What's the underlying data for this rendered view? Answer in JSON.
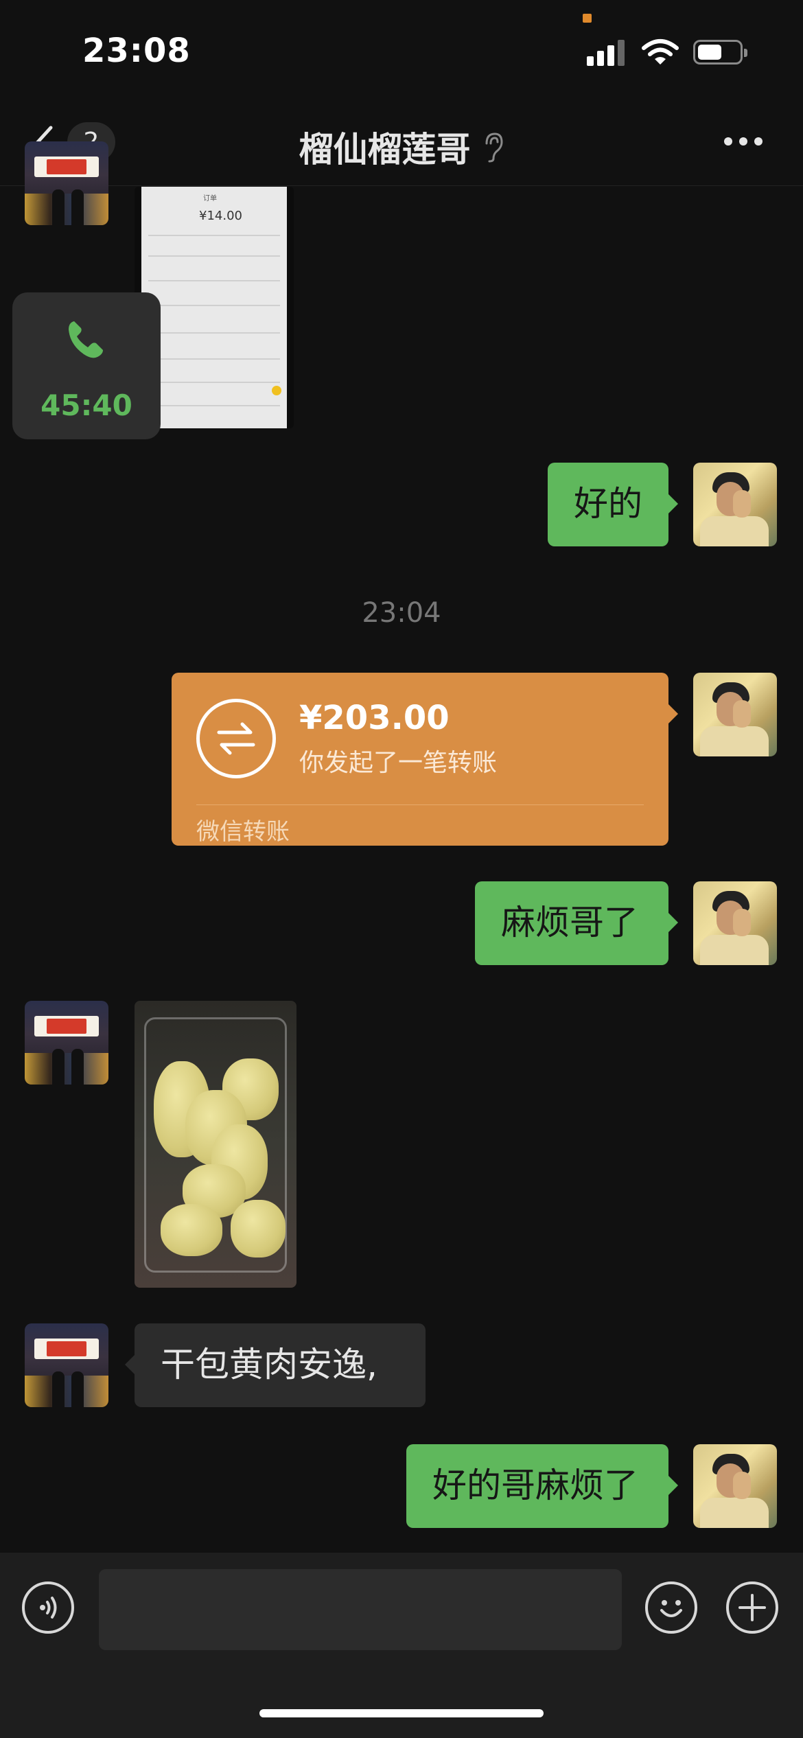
{
  "status_bar": {
    "time": "23:08"
  },
  "header": {
    "unread_count": "2",
    "title": "榴仙榴莲哥"
  },
  "call": {
    "duration": "45:40"
  },
  "messages": {
    "m1": "好的",
    "m2": "麻烦哥了",
    "m3": "干包黄肉安逸,",
    "m4": "好的哥麻烦了"
  },
  "timestamp": "23:04",
  "transfer": {
    "amount": "¥203.00",
    "description": "你发起了一笔转账",
    "label": "微信转账"
  },
  "screenshot_text": {
    "price": "¥14.00",
    "header": "订单"
  },
  "colors": {
    "outgoing_bubble": "#5fb85c",
    "transfer_card": "#d98e44",
    "background": "#111111"
  }
}
